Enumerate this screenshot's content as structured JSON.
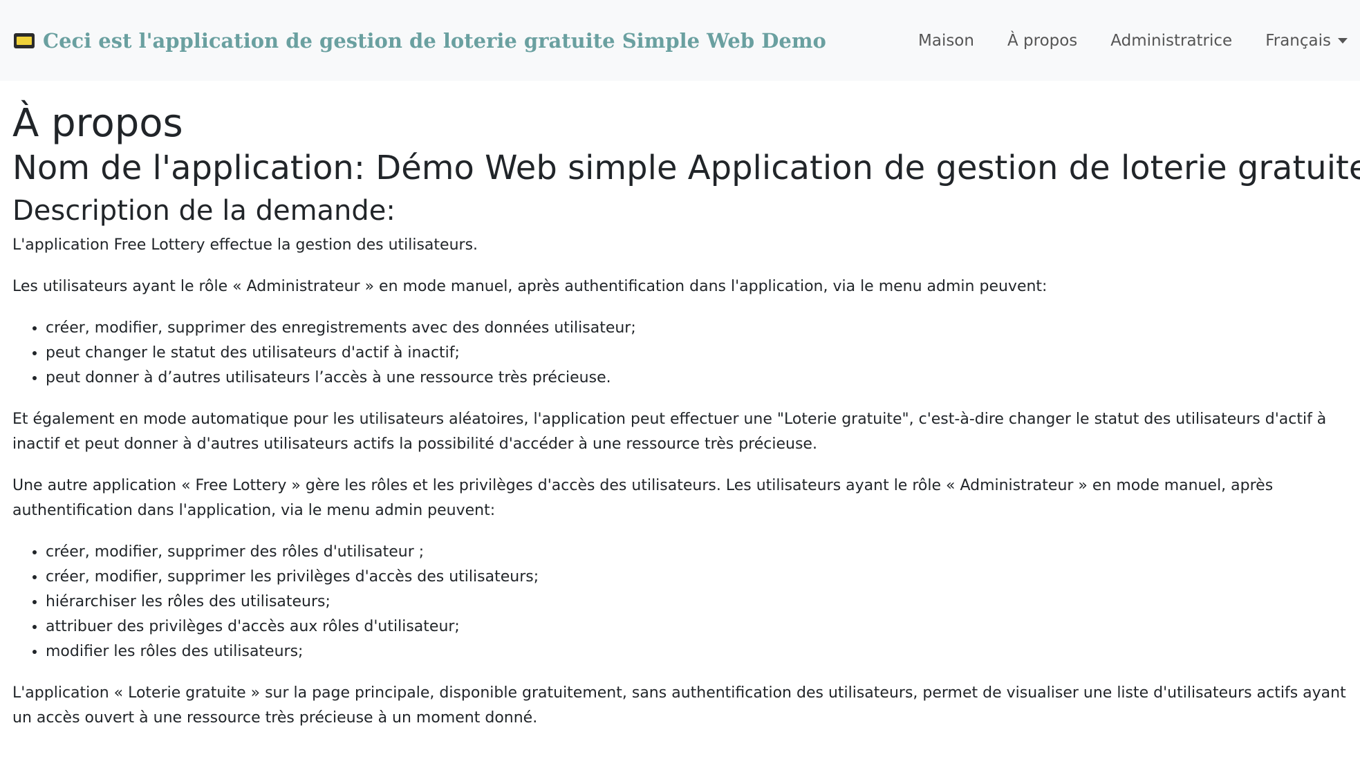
{
  "header": {
    "brand_icon": "monitor-icon",
    "title": "Ceci est l'application de gestion de loterie gratuite Simple Web Demo",
    "title_color": "#6aa0a0",
    "nav": [
      "Maison",
      "À propos",
      "Administratrice",
      "Français"
    ]
  },
  "main": {
    "h1": "À propos",
    "app_name": "Nom de l'application: Démo Web simple Application de gestion de loterie gratuite",
    "description_title": "Description de la demande:",
    "p1": "L'application Free Lottery effectue la gestion des utilisateurs.",
    "p2": "Les utilisateurs ayant le rôle « Administrateur » en mode manuel, après authentification dans l'application, via le menu admin peuvent:",
    "list1": [
      "créer, modifier, supprimer des enregistrements avec des données utilisateur;",
      "peut changer le statut des utilisateurs d'actif à inactif;",
      "peut donner à d’autres utilisateurs l’accès à une ressource très précieuse."
    ],
    "p3": "Et également en mode automatique pour les utilisateurs aléatoires, l'application peut effectuer une \"Loterie gratuite\", c'est-à-dire changer le statut des utilisateurs d'actif à inactif et peut donner à d'autres utilisateurs actifs la possibilité d'accéder à une ressource très précieuse.",
    "p4": "Une autre application « Free Lottery » gère les rôles et les privilèges d'accès des utilisateurs. Les utilisateurs ayant le rôle « Administrateur » en mode manuel, après authentification dans l'application, via le menu admin peuvent:",
    "list2": [
      "créer, modifier, supprimer des rôles d'utilisateur ;",
      "créer, modifier, supprimer les privilèges d'accès des utilisateurs;",
      "hiérarchiser les rôles des utilisateurs;",
      "attribuer des privilèges d'accès aux rôles d'utilisateur;",
      "modifier les rôles des utilisateurs;"
    ],
    "p5": "L'application « Loterie gratuite » sur la page principale, disponible gratuitement, sans authentification des utilisateurs, permet de visualiser une liste d'utilisateurs actifs ayant un accès ouvert à une ressource très précieuse à un moment donné."
  }
}
